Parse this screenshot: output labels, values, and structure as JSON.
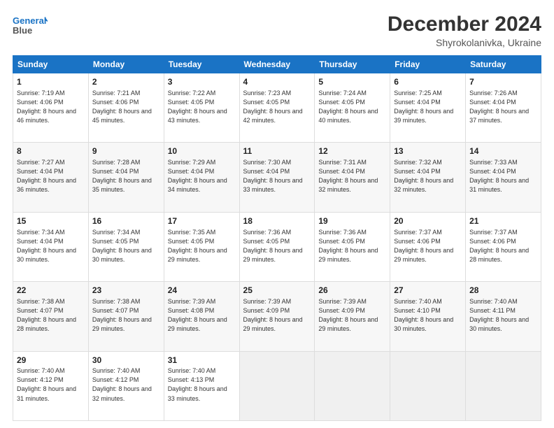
{
  "header": {
    "logo_line1": "General",
    "logo_line2": "Blue",
    "month_title": "December 2024",
    "subtitle": "Shyrokolanivka, Ukraine"
  },
  "days_of_week": [
    "Sunday",
    "Monday",
    "Tuesday",
    "Wednesday",
    "Thursday",
    "Friday",
    "Saturday"
  ],
  "weeks": [
    [
      {
        "day": "1",
        "sunrise": "Sunrise: 7:19 AM",
        "sunset": "Sunset: 4:06 PM",
        "daylight": "Daylight: 8 hours and 46 minutes."
      },
      {
        "day": "2",
        "sunrise": "Sunrise: 7:21 AM",
        "sunset": "Sunset: 4:06 PM",
        "daylight": "Daylight: 8 hours and 45 minutes."
      },
      {
        "day": "3",
        "sunrise": "Sunrise: 7:22 AM",
        "sunset": "Sunset: 4:05 PM",
        "daylight": "Daylight: 8 hours and 43 minutes."
      },
      {
        "day": "4",
        "sunrise": "Sunrise: 7:23 AM",
        "sunset": "Sunset: 4:05 PM",
        "daylight": "Daylight: 8 hours and 42 minutes."
      },
      {
        "day": "5",
        "sunrise": "Sunrise: 7:24 AM",
        "sunset": "Sunset: 4:05 PM",
        "daylight": "Daylight: 8 hours and 40 minutes."
      },
      {
        "day": "6",
        "sunrise": "Sunrise: 7:25 AM",
        "sunset": "Sunset: 4:04 PM",
        "daylight": "Daylight: 8 hours and 39 minutes."
      },
      {
        "day": "7",
        "sunrise": "Sunrise: 7:26 AM",
        "sunset": "Sunset: 4:04 PM",
        "daylight": "Daylight: 8 hours and 37 minutes."
      }
    ],
    [
      {
        "day": "8",
        "sunrise": "Sunrise: 7:27 AM",
        "sunset": "Sunset: 4:04 PM",
        "daylight": "Daylight: 8 hours and 36 minutes."
      },
      {
        "day": "9",
        "sunrise": "Sunrise: 7:28 AM",
        "sunset": "Sunset: 4:04 PM",
        "daylight": "Daylight: 8 hours and 35 minutes."
      },
      {
        "day": "10",
        "sunrise": "Sunrise: 7:29 AM",
        "sunset": "Sunset: 4:04 PM",
        "daylight": "Daylight: 8 hours and 34 minutes."
      },
      {
        "day": "11",
        "sunrise": "Sunrise: 7:30 AM",
        "sunset": "Sunset: 4:04 PM",
        "daylight": "Daylight: 8 hours and 33 minutes."
      },
      {
        "day": "12",
        "sunrise": "Sunrise: 7:31 AM",
        "sunset": "Sunset: 4:04 PM",
        "daylight": "Daylight: 8 hours and 32 minutes."
      },
      {
        "day": "13",
        "sunrise": "Sunrise: 7:32 AM",
        "sunset": "Sunset: 4:04 PM",
        "daylight": "Daylight: 8 hours and 32 minutes."
      },
      {
        "day": "14",
        "sunrise": "Sunrise: 7:33 AM",
        "sunset": "Sunset: 4:04 PM",
        "daylight": "Daylight: 8 hours and 31 minutes."
      }
    ],
    [
      {
        "day": "15",
        "sunrise": "Sunrise: 7:34 AM",
        "sunset": "Sunset: 4:04 PM",
        "daylight": "Daylight: 8 hours and 30 minutes."
      },
      {
        "day": "16",
        "sunrise": "Sunrise: 7:34 AM",
        "sunset": "Sunset: 4:05 PM",
        "daylight": "Daylight: 8 hours and 30 minutes."
      },
      {
        "day": "17",
        "sunrise": "Sunrise: 7:35 AM",
        "sunset": "Sunset: 4:05 PM",
        "daylight": "Daylight: 8 hours and 29 minutes."
      },
      {
        "day": "18",
        "sunrise": "Sunrise: 7:36 AM",
        "sunset": "Sunset: 4:05 PM",
        "daylight": "Daylight: 8 hours and 29 minutes."
      },
      {
        "day": "19",
        "sunrise": "Sunrise: 7:36 AM",
        "sunset": "Sunset: 4:05 PM",
        "daylight": "Daylight: 8 hours and 29 minutes."
      },
      {
        "day": "20",
        "sunrise": "Sunrise: 7:37 AM",
        "sunset": "Sunset: 4:06 PM",
        "daylight": "Daylight: 8 hours and 29 minutes."
      },
      {
        "day": "21",
        "sunrise": "Sunrise: 7:37 AM",
        "sunset": "Sunset: 4:06 PM",
        "daylight": "Daylight: 8 hours and 28 minutes."
      }
    ],
    [
      {
        "day": "22",
        "sunrise": "Sunrise: 7:38 AM",
        "sunset": "Sunset: 4:07 PM",
        "daylight": "Daylight: 8 hours and 28 minutes."
      },
      {
        "day": "23",
        "sunrise": "Sunrise: 7:38 AM",
        "sunset": "Sunset: 4:07 PM",
        "daylight": "Daylight: 8 hours and 29 minutes."
      },
      {
        "day": "24",
        "sunrise": "Sunrise: 7:39 AM",
        "sunset": "Sunset: 4:08 PM",
        "daylight": "Daylight: 8 hours and 29 minutes."
      },
      {
        "day": "25",
        "sunrise": "Sunrise: 7:39 AM",
        "sunset": "Sunset: 4:09 PM",
        "daylight": "Daylight: 8 hours and 29 minutes."
      },
      {
        "day": "26",
        "sunrise": "Sunrise: 7:39 AM",
        "sunset": "Sunset: 4:09 PM",
        "daylight": "Daylight: 8 hours and 29 minutes."
      },
      {
        "day": "27",
        "sunrise": "Sunrise: 7:40 AM",
        "sunset": "Sunset: 4:10 PM",
        "daylight": "Daylight: 8 hours and 30 minutes."
      },
      {
        "day": "28",
        "sunrise": "Sunrise: 7:40 AM",
        "sunset": "Sunset: 4:11 PM",
        "daylight": "Daylight: 8 hours and 30 minutes."
      }
    ],
    [
      {
        "day": "29",
        "sunrise": "Sunrise: 7:40 AM",
        "sunset": "Sunset: 4:12 PM",
        "daylight": "Daylight: 8 hours and 31 minutes."
      },
      {
        "day": "30",
        "sunrise": "Sunrise: 7:40 AM",
        "sunset": "Sunset: 4:12 PM",
        "daylight": "Daylight: 8 hours and 32 minutes."
      },
      {
        "day": "31",
        "sunrise": "Sunrise: 7:40 AM",
        "sunset": "Sunset: 4:13 PM",
        "daylight": "Daylight: 8 hours and 33 minutes."
      },
      null,
      null,
      null,
      null
    ]
  ]
}
